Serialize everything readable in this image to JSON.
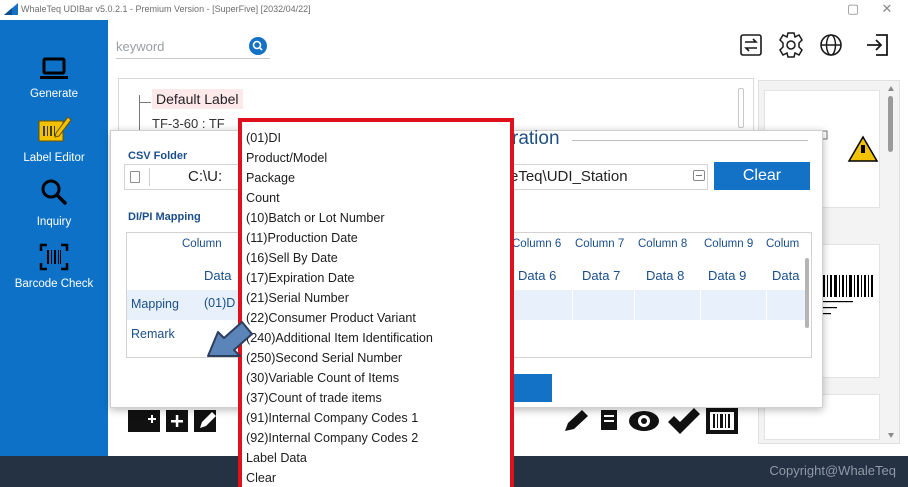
{
  "window": {
    "title": "WhaleTeq UDIBar v5.0.2.1 - Premium Version - [SuperFive] [2032/04/22]",
    "minimize_glyph": "▢",
    "close_glyph": "✕"
  },
  "sidebar": {
    "items": [
      {
        "label": "Generate",
        "icon": "laptop-icon",
        "active": false
      },
      {
        "label": "Label Editor",
        "icon": "label-editor-icon",
        "active": true
      },
      {
        "label": "Inquiry",
        "icon": "search-icon",
        "active": false
      },
      {
        "label": "Barcode Check",
        "icon": "barcode-scan-icon",
        "active": false
      }
    ],
    "color": "#0d72c7"
  },
  "toolbar": {
    "search_placeholder": "keyword",
    "icons": [
      "import-export-icon",
      "settings-icon",
      "language-globe-icon",
      "logout-icon"
    ]
  },
  "tree": {
    "root_label": "Default Label",
    "child_label": "TF-3-60 : TF"
  },
  "dialog": {
    "title": "ration",
    "csv_section": "CSV Folder",
    "csv_path_left": "C:\\U:",
    "csv_path_right": "eTeq\\UDI_Station",
    "clear_label": "Clear",
    "mapping_section": "DI/PI Mapping",
    "columns": [
      {
        "head": "Column",
        "data": "Data"
      },
      {
        "head": "Column 6",
        "data": "Data 6"
      },
      {
        "head": "Column 7",
        "data": "Data 7"
      },
      {
        "head": "Column 8",
        "data": "Data 8"
      },
      {
        "head": "Column 9",
        "data": "Data 9"
      },
      {
        "head": "Colum",
        "data": "Data"
      }
    ],
    "row_mapping": "Mapping",
    "row_remark": "Remark",
    "mapping_value": "(01)D"
  },
  "dropdown": {
    "options": [
      "(01)DI",
      "Product/Model",
      "Package",
      "Count",
      "(10)Batch or Lot Number",
      "(11)Production Date",
      "(16)Sell By Date",
      "(17)Expiration Date",
      "(21)Serial Number",
      "(22)Consumer Product Variant",
      "(240)Additional Item Identification",
      "(250)Second Serial Number",
      "(30)Variable Count of Items",
      "(37)Count of trade items",
      "(91)Internal Company Codes 1",
      "(92)Internal Company Codes 2",
      "Label Data",
      "Clear"
    ],
    "highlight_color": "#e0101d"
  },
  "footer": {
    "copyright": "Copyright@WhaleTeq"
  },
  "colors": {
    "accent": "#1472c6",
    "footer": "#253243"
  }
}
